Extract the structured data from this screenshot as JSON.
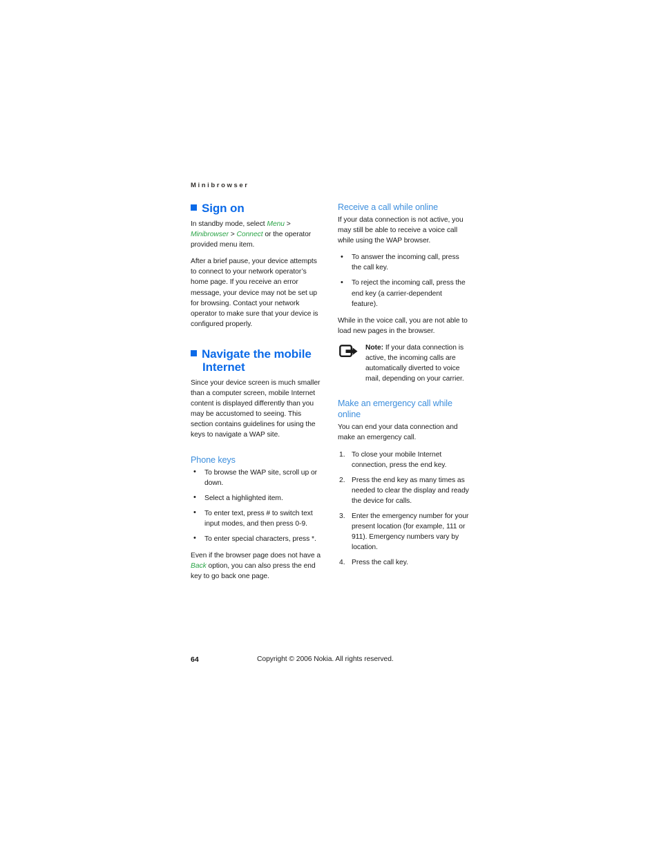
{
  "document": {
    "running_header": "Minibrowser",
    "page_number": "64",
    "copyright": "Copyright © 2006 Nokia. All rights reserved."
  },
  "colors": {
    "heading_blue": "#0b6ae8",
    "subheading_blue": "#3c8edd",
    "emphasis_green": "#2ba447",
    "body_text": "#1c1c1c"
  },
  "left_column": {
    "sign_on": {
      "title": "Sign on",
      "para_1_a": "In standby mode, select ",
      "para_1_menu": "Menu",
      "para_1_gt1": " > ",
      "para_1_minibrowser": "Minibrowser",
      "para_1_gt2": " > ",
      "para_1_connect": "Connect",
      "para_1_b": " or the operator provided menu item.",
      "para_2": "After a brief pause, your device attempts to connect to your network operator’s home page. If you receive an error message, your device may not be set up for browsing. Contact your network operator to make sure that your device is configured properly."
    },
    "navigate": {
      "title": "Navigate the mobile Internet",
      "para_1": "Since your device screen is much smaller than a computer screen, mobile Internet content is displayed differently than you may be accustomed to seeing. This section contains guidelines for using the keys to navigate a WAP site."
    },
    "phone_keys": {
      "title": "Phone keys",
      "bullets": [
        "To browse the WAP site, scroll up or down.",
        "Select a highlighted item.",
        "To enter text, press # to switch text input modes, and then press 0-9.",
        "To enter special characters, press *."
      ],
      "closing_a": "Even if the browser page does not have a ",
      "closing_back": "Back",
      "closing_b": " option, you can also press the end key to go back one page."
    }
  },
  "right_column": {
    "receive_call": {
      "title": "Receive a call while online",
      "para_1": "If your data connection is not active, you may still be able to receive a voice call while using the WAP browser.",
      "bullets": [
        "To answer the incoming call, press the call key.",
        "To reject the incoming call, press the end key (a carrier-dependent feature)."
      ],
      "para_2": "While in the voice call, you are not able to load new pages in the browser.",
      "note_label": "Note:",
      "note_body": " If your data connection is active, the incoming calls are automatically diverted to voice mail, depending on your carrier.",
      "note_icon": "note-arrow-icon"
    },
    "emergency_call": {
      "title": "Make an emergency call while online",
      "para_1": "You can end your data connection and make an emergency call.",
      "steps": [
        "To close your mobile Internet connection, press the end key.",
        "Press the end key as many times as needed to clear the display and ready the device for calls.",
        "Enter the emergency number for your present location (for example, 111 or 911). Emergency numbers vary by location.",
        "Press the call key."
      ]
    }
  }
}
